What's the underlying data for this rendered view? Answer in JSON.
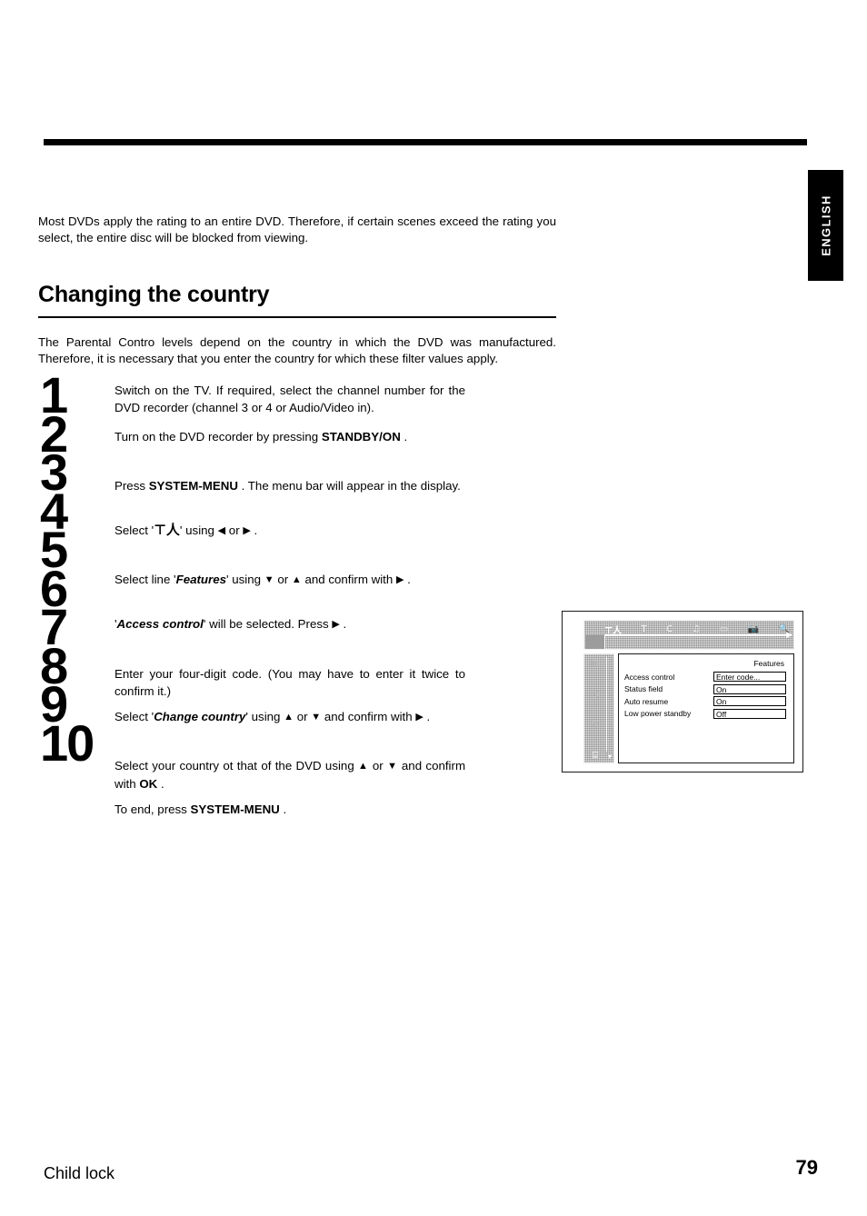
{
  "page": {
    "language_tab": "ENGLISH",
    "footer_section": "Child lock",
    "page_number": "79"
  },
  "intro": {
    "paragraph": "Most DVDs apply the rating to an entire DVD. Therefore, if certain scenes exceed the rating you select, the entire disc will be blocked from viewing."
  },
  "section": {
    "heading": "Changing the country",
    "lead": "The Parental Contro levels depend on the country in which the DVD was manufactured. Therefore, it is necessary that you enter the country for which these filter values apply."
  },
  "steps": [
    {
      "number": "1",
      "parts": [
        {
          "t": "text",
          "v": "Switch on the TV. If required, select the channel number for the DVD recorder (channel 3 or 4 or Audio/Video in)."
        }
      ]
    },
    {
      "number": "2",
      "parts": [
        {
          "t": "text",
          "v": "Turn on the DVD recorder by pressing "
        },
        {
          "t": "key",
          "v": "STANDBY/ON"
        },
        {
          "t": "text",
          "v": " ."
        }
      ]
    },
    {
      "number": "3",
      "parts": [
        {
          "t": "text",
          "v": "Press "
        },
        {
          "t": "key",
          "v": "SYSTEM-MENU"
        },
        {
          "t": "text",
          "v": " . The menu bar will appear in the display."
        }
      ]
    },
    {
      "number": "4",
      "parts": [
        {
          "t": "text",
          "v": "Select '"
        },
        {
          "t": "glyph",
          "v": "⊤人"
        },
        {
          "t": "text",
          "v": "' using "
        },
        {
          "t": "arrow",
          "v": "◀"
        },
        {
          "t": "text",
          "v": " or "
        },
        {
          "t": "arrow",
          "v": "▶"
        },
        {
          "t": "text",
          "v": " ."
        }
      ]
    },
    {
      "number": "5",
      "parts": [
        {
          "t": "text",
          "v": "Select line '"
        },
        {
          "t": "emph",
          "v": "Features"
        },
        {
          "t": "text",
          "v": "' using "
        },
        {
          "t": "arrow",
          "v": "▼"
        },
        {
          "t": "text",
          "v": " or "
        },
        {
          "t": "arrow",
          "v": "▲"
        },
        {
          "t": "text",
          "v": " and confirm with "
        },
        {
          "t": "arrow",
          "v": "▶"
        },
        {
          "t": "text",
          "v": " ."
        }
      ]
    },
    {
      "number": "6",
      "parts": [
        {
          "t": "text",
          "v": "'"
        },
        {
          "t": "emph",
          "v": "Access control"
        },
        {
          "t": "text",
          "v": "' will be selected. Press "
        },
        {
          "t": "arrow",
          "v": "▶"
        },
        {
          "t": "text",
          "v": " ."
        }
      ]
    },
    {
      "number": "7",
      "parts": [
        {
          "t": "text",
          "v": "Enter your four-digit code. (You may have to enter it twice to confirm it.)"
        }
      ]
    },
    {
      "number": "8",
      "parts": [
        {
          "t": "text",
          "v": "Select '"
        },
        {
          "t": "emph",
          "v": "Change country"
        },
        {
          "t": "text",
          "v": "' using "
        },
        {
          "t": "arrow",
          "v": "▲"
        },
        {
          "t": "text",
          "v": " or "
        },
        {
          "t": "arrow",
          "v": "▼"
        },
        {
          "t": "text",
          "v": " and confirm with "
        },
        {
          "t": "arrow",
          "v": "▶"
        },
        {
          "t": "text",
          "v": " ."
        }
      ]
    },
    {
      "number": "9",
      "parts": [
        {
          "t": "text",
          "v": "Select your country ot that of the DVD using "
        },
        {
          "t": "arrow",
          "v": "▲"
        },
        {
          "t": "text",
          "v": " or "
        },
        {
          "t": "arrow",
          "v": "▼"
        },
        {
          "t": "text",
          "v": " and confirm with "
        },
        {
          "t": "key",
          "v": "OK"
        },
        {
          "t": "text",
          "v": " ."
        }
      ]
    },
    {
      "number": "10",
      "parts": [
        {
          "t": "text",
          "v": "To end, press "
        },
        {
          "t": "key",
          "v": "SYSTEM-MENU"
        },
        {
          "t": "text",
          "v": " ."
        }
      ]
    }
  ],
  "tv_screen": {
    "menubar_icons": [
      {
        "name": "tools-icon",
        "glyph": "⊤人",
        "active": true
      },
      {
        "name": "timer-icon",
        "glyph": "T",
        "active": false
      },
      {
        "name": "clock-icon",
        "glyph": "C",
        "active": false
      },
      {
        "name": "audio-icon",
        "glyph": "♫",
        "active": false
      },
      {
        "name": "display-icon",
        "glyph": "▭",
        "active": false
      },
      {
        "name": "camera-icon",
        "glyph": "📷",
        "active": false
      },
      {
        "name": "zoom-icon",
        "glyph": "🔍",
        "active": false
      }
    ],
    "sidebar_icons": [
      {
        "name": "picture-icon",
        "glyph": "▣",
        "active": false
      },
      {
        "name": "sound-icon",
        "glyph": "◁",
        "active": false
      },
      {
        "name": "subtitle-icon",
        "glyph": "▽",
        "active": false
      },
      {
        "name": "features-icon",
        "glyph": "⌸",
        "active": true
      }
    ],
    "scroll_indicator": "▾",
    "panel_title": "Features",
    "features": [
      {
        "label": "Access control",
        "value": "Enter code..."
      },
      {
        "label": "Status field",
        "value": "On"
      },
      {
        "label": "Auto resume",
        "value": "On"
      },
      {
        "label": "Low power standby",
        "value": "Off"
      }
    ]
  }
}
